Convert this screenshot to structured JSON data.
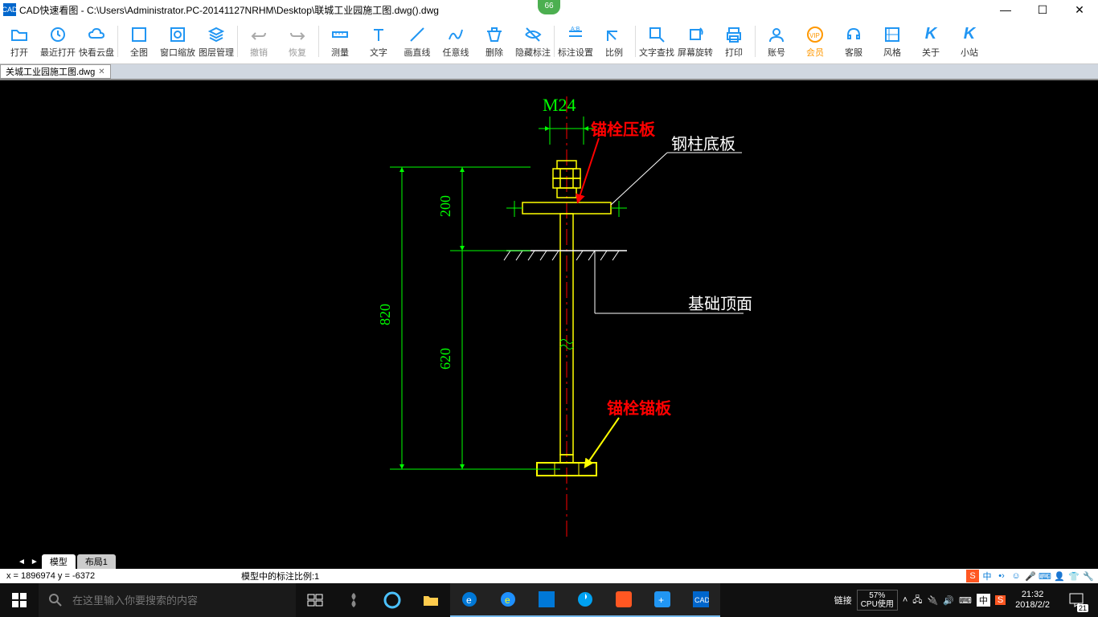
{
  "titlebar": {
    "app_name": "CAD快速看图",
    "path": "C:\\Users\\Administrator.PC-20141127NRHM\\Desktop\\联城工业园施工图.dwg().dwg",
    "badge": "66"
  },
  "toolbar": {
    "open": "打开",
    "recent": "最近打开",
    "cloud": "快看云盘",
    "full": "全图",
    "window_zoom": "窗口缩放",
    "layers": "图层管理",
    "undo": "撤销",
    "redo": "恢复",
    "measure": "测量",
    "text": "文字",
    "line": "画直线",
    "freeline": "任意线",
    "delete": "删除",
    "hide_annot": "隐藏标注",
    "annot_setting": "标注设置",
    "scale": "比例",
    "text_search": "文字查找",
    "rotate": "屏幕旋转",
    "print": "打印",
    "account": "账号",
    "vip": "会员",
    "service": "客服",
    "style": "风格",
    "about": "关于",
    "station": "小站"
  },
  "tab": {
    "filename": "关城工业园施工图.dwg"
  },
  "drawing": {
    "spec": "M24",
    "label_bolt_plate": "锚栓压板",
    "label_base_plate": "钢柱底板",
    "label_foundation": "基础顶面",
    "label_anchor": "锚栓锚板",
    "dim_200": "200",
    "dim_820": "820",
    "dim_620": "620"
  },
  "model_tabs": {
    "model": "模型",
    "layout1": "布局1"
  },
  "status": {
    "coords": "x = 1896974  y = -6372",
    "scale_info": "模型中的标注比例:1"
  },
  "statusbar_ime": "中",
  "taskbar": {
    "search_placeholder": "在这里输入你要搜索的内容",
    "link_label": "链接",
    "cpu_pct": "57%",
    "cpu_label": "CPU使用",
    "ime": "中",
    "time": "21:32",
    "date": "2018/2/2",
    "notif_count": "21"
  }
}
